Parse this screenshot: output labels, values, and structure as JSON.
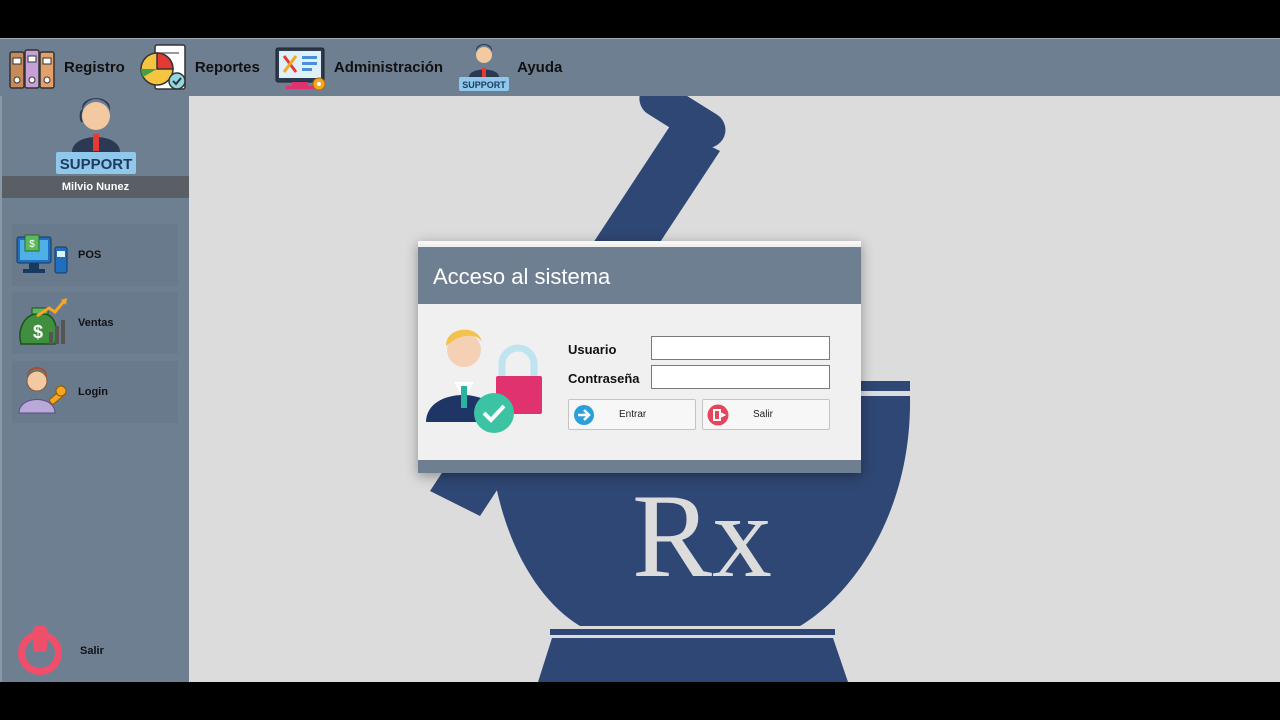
{
  "menubar": {
    "items": [
      {
        "label": "Registro",
        "icon": "binders-icon"
      },
      {
        "label": "Reportes",
        "icon": "report-chart-icon"
      },
      {
        "label": "Administración",
        "icon": "admin-tools-icon"
      },
      {
        "label": "Ayuda",
        "icon": "support-agent-icon",
        "icon_text": "SUPPORT"
      }
    ]
  },
  "sidebar": {
    "avatar_text": "SUPPORT",
    "user_name": "Milvio Nunez",
    "buttons": [
      {
        "label": "POS",
        "icon": "pos-terminal-icon"
      },
      {
        "label": "Ventas",
        "icon": "money-growth-icon"
      },
      {
        "label": "Login",
        "icon": "user-key-icon"
      }
    ],
    "exit_label": "Salir",
    "exit_icon": "power-icon"
  },
  "background": {
    "logo_text": "Rx",
    "logo_icon": "mortar-pestle-icon"
  },
  "dialog": {
    "title": "Acceso al sistema",
    "illustration": "user-lock-icon",
    "usuario_label": "Usuario",
    "usuario_value": "",
    "password_label": "Contraseña",
    "password_value": "",
    "enter_label": "Entrar",
    "exit_label": "Salir"
  },
  "colors": {
    "bar": "#6f7f92",
    "logo": "#2f4774",
    "background": "#dcdcdc",
    "accent_pink": "#e0326e"
  }
}
